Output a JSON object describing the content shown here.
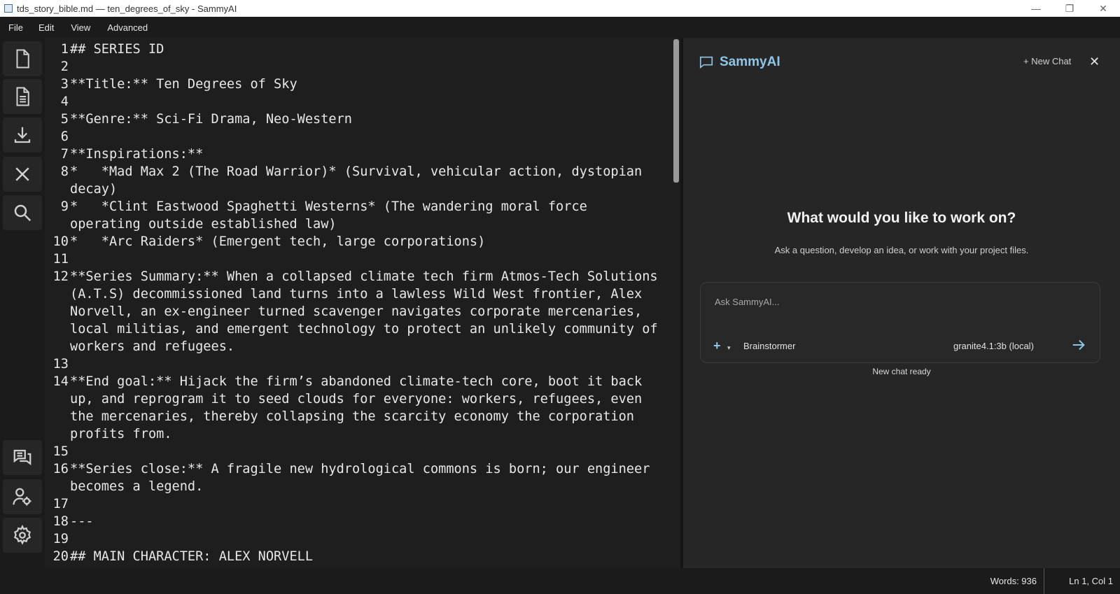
{
  "window": {
    "title": "tds_story_bible.md — ten_degrees_of_sky - SammyAI"
  },
  "menu": [
    "File",
    "Edit",
    "View",
    "Advanced"
  ],
  "sidebar": {
    "top_icons": [
      "new-file-icon",
      "document-icon",
      "download-icon",
      "close-icon",
      "search-icon"
    ],
    "bottom_icons": [
      "chat-icon",
      "user-settings-icon",
      "gear-icon"
    ]
  },
  "editor": {
    "lines": [
      {
        "n": "1",
        "text": "## SERIES ID"
      },
      {
        "n": "2",
        "text": ""
      },
      {
        "n": "3",
        "text": "**Title:** Ten Degrees of Sky"
      },
      {
        "n": "4",
        "text": ""
      },
      {
        "n": "5",
        "text": "**Genre:** Sci-Fi Drama, Neo-Western"
      },
      {
        "n": "6",
        "text": ""
      },
      {
        "n": "7",
        "text": "**Inspirations:**"
      },
      {
        "n": "8",
        "text": "*   *Mad Max 2 (The Road Warrior)* (Survival, vehicular action, dystopian decay)"
      },
      {
        "n": "9",
        "text": "*   *Clint Eastwood Spaghetti Westerns* (The wandering moral force operating outside established law)"
      },
      {
        "n": "10",
        "text": "*   *Arc Raiders* (Emergent tech, large corporations)"
      },
      {
        "n": "11",
        "text": ""
      },
      {
        "n": "12",
        "text": "**Series Summary:** When a collapsed climate tech firm Atmos-Tech Solutions (A.T.S) decommissioned land turns into a lawless Wild West frontier, Alex Norvell, an ex-engineer turned scavenger navigates corporate mercenaries, local militias, and emergent technology to protect an unlikely community of workers and refugees."
      },
      {
        "n": "13",
        "text": ""
      },
      {
        "n": "14",
        "text": "**End goal:** Hijack the firm’s abandoned climate-tech core, boot it back up, and reprogram it to seed clouds for everyone: workers, refugees, even the mercenaries, thereby collapsing the scarcity economy the corporation profits from."
      },
      {
        "n": "15",
        "text": ""
      },
      {
        "n": "16",
        "text": "**Series close:** A fragile new hydrological commons is born; our engineer becomes a legend."
      },
      {
        "n": "17",
        "text": ""
      },
      {
        "n": "18",
        "text": "---"
      },
      {
        "n": "19",
        "text": ""
      },
      {
        "n": "20",
        "text": "## MAIN CHARACTER: ALEX NORVELL"
      }
    ]
  },
  "chat": {
    "title": "SammyAI",
    "new_chat": "+ New Chat",
    "close": "✕",
    "heading": "What would you like to work on?",
    "subheading": "Ask a question, develop an idea, or work with your project files.",
    "input_placeholder": "Ask SammyAI...",
    "mode": "Brainstormer",
    "model": "granite4.1:3b (local)",
    "status": "New chat ready",
    "accent": "#8fc6e8"
  },
  "statusbar": {
    "words": "Words: 936",
    "position": "Ln 1, Col 1"
  }
}
